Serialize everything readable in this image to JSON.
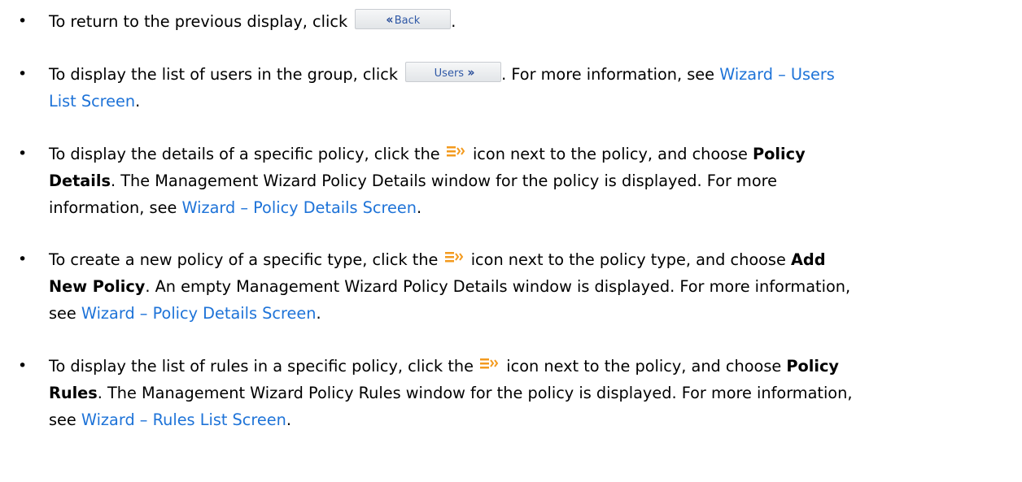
{
  "bullet_glyph": "•",
  "icons": {
    "back_button": "double-chevron-left-icon",
    "users_button": "double-chevron-right-icon",
    "menu_icon": "list-menu-icon",
    "accent_color": "#f39a1e",
    "link_color": "#1e73d8"
  },
  "items": [
    {
      "text1": "To return to the previous display, click",
      "button_label": "Back",
      "text2": "."
    },
    {
      "text1": "To display the list of users in the group, click",
      "button_label": "Users",
      "text2": ". For more information, see",
      "link_a": "Wizard – Users",
      "link_b": "List Screen",
      "text3": "."
    },
    {
      "text1": "To display the details of a specific policy, click the",
      "text2": "icon next to the policy, and choose",
      "bold_a": "Policy",
      "bold_b": "Details",
      "text3": ". The Management Wizard Policy Details window for the policy is displayed. For more",
      "text4": "information, see",
      "link": "Wizard – Policy Details Screen",
      "text5": "."
    },
    {
      "text1": "To create a new policy of a specific type, click the",
      "text2": "icon next to the policy type, and choose",
      "bold_a": "Add",
      "bold_b": "New Policy",
      "text3": ". An empty Management Wizard Policy Details window is displayed. For more information,",
      "text4": "see",
      "link": "Wizard – Policy Details Screen",
      "text5": "."
    },
    {
      "text1": "To display the list of rules in a specific policy, click the",
      "text2": "icon next to the policy, and choose",
      "bold_a": "Policy",
      "bold_b": "Rules",
      "text3": ". The Management Wizard Policy Rules window for the policy is displayed. For more information,",
      "text4": "see",
      "link": "Wizard – Rules List Screen",
      "text5": "."
    }
  ]
}
